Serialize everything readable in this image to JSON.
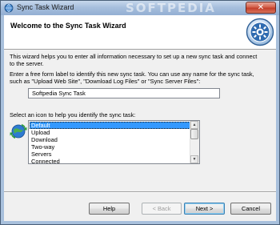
{
  "window": {
    "title": "Sync Task Wizard",
    "watermark": "SOFTPEDIA",
    "close_glyph": "✕"
  },
  "header": {
    "title": "Welcome to the Sync Task Wizard"
  },
  "intro": {
    "line1": "This wizard helps you to enter all information necessary to set up a new sync task and connect",
    "line2": "to the server."
  },
  "label_prompt": {
    "line1": "Enter a free form label to identify this new sync task. You can use any name for the sync task,",
    "line2": "such as \"Upload Web Site\", \"Download Log Files\" or \"Sync Server Files\":"
  },
  "task_name": {
    "value": "Softpedia Sync Task"
  },
  "icon_prompt": {
    "text": "Select an icon to help you identify the sync task:"
  },
  "icon_list": {
    "items": [
      "Default",
      "Upload",
      "Download",
      "Two-way",
      "Servers",
      "Connected"
    ],
    "selected": "Default"
  },
  "buttons": {
    "help": "Help",
    "back": "< Back",
    "next": "Next >",
    "cancel": "Cancel"
  },
  "icons": {
    "title": "sync-globe-icon",
    "header": "wizard-logo-icon",
    "list": "default-sync-icon"
  },
  "colors": {
    "selection": "#3399ff",
    "titlebar": "#a7bfdd",
    "close_button": "#c43f2b"
  }
}
